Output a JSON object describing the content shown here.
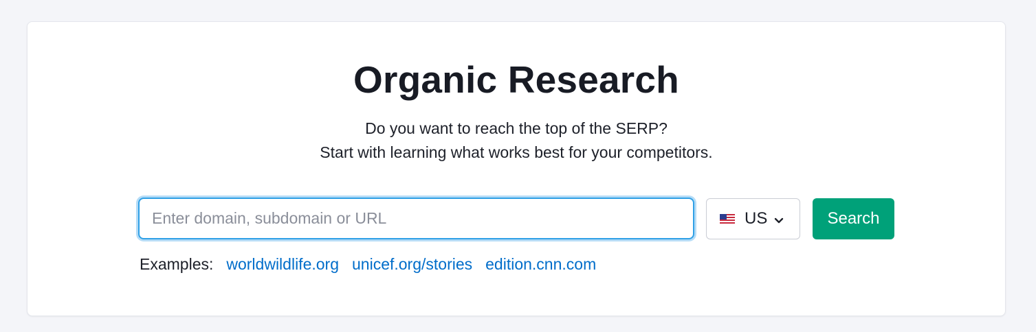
{
  "page": {
    "title": "Organic Research",
    "subtitle_line1": "Do you want to reach the top of the SERP?",
    "subtitle_line2": "Start with learning what works best for your competitors."
  },
  "search": {
    "placeholder": "Enter domain, subdomain or URL",
    "value": "",
    "database": {
      "selected": "US",
      "flag_icon": "us-flag-icon",
      "dropdown_icon": "chevron-down-icon"
    },
    "button_label": "Search"
  },
  "examples": {
    "label": "Examples:",
    "links": [
      "worldwildlife.org",
      "unicef.org/stories",
      "edition.cnn.com"
    ]
  },
  "colors": {
    "background": "#f4f5f9",
    "card": "#ffffff",
    "accent_button": "#00a179",
    "focus_border": "#2fa0e6",
    "link": "#006dca",
    "text": "#181b24"
  }
}
